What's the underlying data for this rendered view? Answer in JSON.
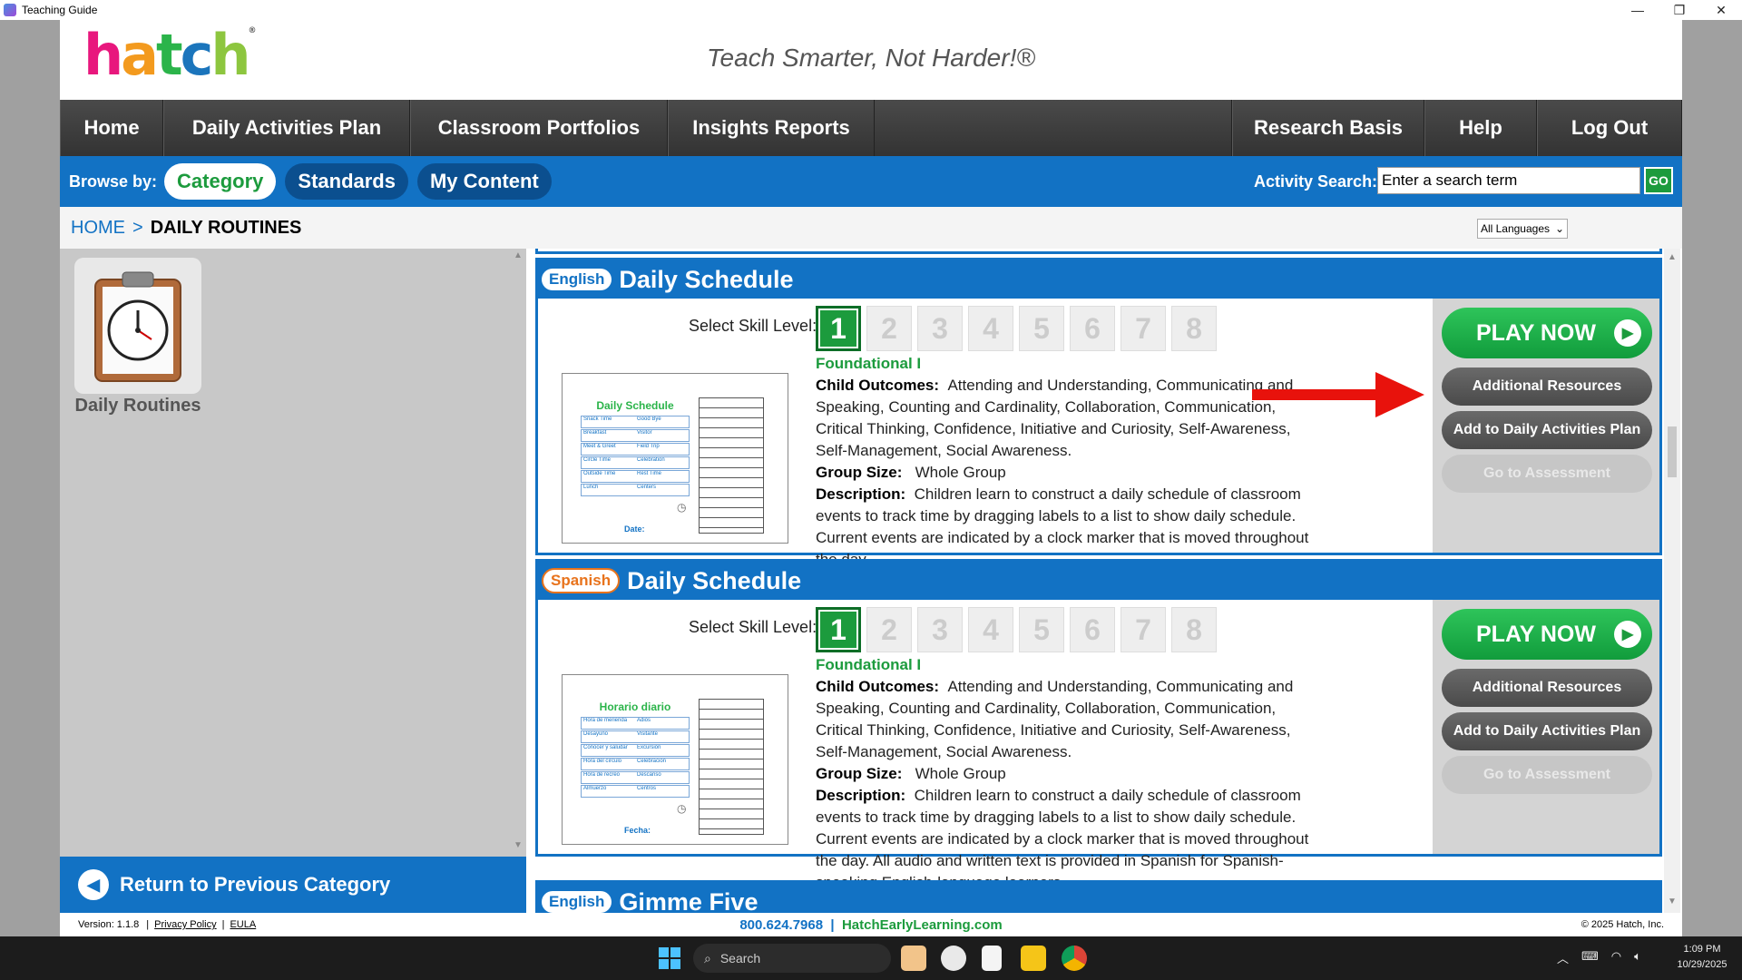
{
  "window": {
    "title": "Teaching Guide",
    "minimize": "—",
    "restore": "❐",
    "close": "✕"
  },
  "header": {
    "logo": {
      "h": "h",
      "a": "a",
      "t": "t",
      "c": "c",
      "h2": "h",
      "reg": "®"
    },
    "tagline": "Teach Smarter, Not Harder!®"
  },
  "nav": {
    "home": "Home",
    "daily_activities_plan": "Daily Activities Plan",
    "classroom_portfolios": "Classroom Portfolios",
    "insights_reports": "Insights Reports",
    "research_basis": "Research Basis",
    "help": "Help",
    "log_out": "Log Out"
  },
  "browse": {
    "label": "Browse by:",
    "category": "Category",
    "standards": "Standards",
    "my_content": "My Content",
    "search_label": "Activity Search:",
    "search_value": "Enter a search term",
    "go": "GO"
  },
  "breadcrumb": {
    "home": "HOME",
    "sep": ">",
    "current": "DAILY ROUTINES",
    "language": "All Languages",
    "language_caret": "⌄"
  },
  "left_panel": {
    "category_label": "Daily Routines",
    "return_label": "Return to Previous Category",
    "return_icon": "◀"
  },
  "skill_label": "Select Skill Level:",
  "skill_levels": [
    "1",
    "2",
    "3",
    "4",
    "5",
    "6",
    "7",
    "8"
  ],
  "cards": [
    {
      "language": "English",
      "title": "Daily Schedule",
      "level": "Foundational I",
      "outcomes_label": "Child Outcomes:",
      "outcomes": "Attending and Understanding, Communicating and Speaking, Counting and Cardinality, Collaboration, Communication, Critical Thinking, Confidence, Initiative and Curiosity, Self-Awareness, Self-Management, Social Awareness.",
      "group_label": "Group Size:",
      "group": "Whole Group",
      "description_label": "Description:",
      "description": "Children learn to construct a daily schedule of classroom events to track time by dragging labels to a list to show daily schedule. Current events are indicated by a clock marker that is moved throughout the day.",
      "thumb_title": "Daily Schedule",
      "thumb_rows": [
        [
          "Snack Time",
          "Good Bye"
        ],
        [
          "Breakfast",
          "Visitor"
        ],
        [
          "Meet & Greet",
          "Field Trip"
        ],
        [
          "Circle Time",
          "Celebration"
        ],
        [
          "Outside Time",
          "Rest Time"
        ],
        [
          "Lunch",
          "Centers"
        ]
      ],
      "thumb_date": "Date:"
    },
    {
      "language": "Spanish",
      "title": "Daily Schedule",
      "level": "Foundational I",
      "outcomes_label": "Child Outcomes:",
      "outcomes": "Attending and Understanding, Communicating and Speaking, Counting and Cardinality, Collaboration, Communication, Critical Thinking, Confidence, Initiative and Curiosity, Self-Awareness, Self-Management, Social Awareness.",
      "group_label": "Group Size:",
      "group": "Whole Group",
      "description_label": "Description:",
      "description": "Children learn to construct a daily schedule of classroom events to track time by dragging labels to a list to show daily schedule. Current events are indicated by a clock marker that is moved throughout the day. All audio and written text is provided in Spanish for Spanish-speaking English-language learners.",
      "thumb_title": "Horario diario",
      "thumb_rows": [
        [
          "Hora de merienda",
          "Adiós"
        ],
        [
          "Desayuno",
          "Visitante"
        ],
        [
          "Conocer y saludar",
          "Excursión"
        ],
        [
          "Hora del círculo",
          "Celebración"
        ],
        [
          "Hora de recreo",
          "Descanso"
        ],
        [
          "Almuerzo",
          "Centros"
        ]
      ],
      "thumb_date": "Fecha:"
    },
    {
      "language": "English",
      "title": "Gimme Five"
    }
  ],
  "buttons": {
    "play_now": "PLAY NOW",
    "play_icon": "▶",
    "additional_resources": "Additional Resources",
    "add_to_plan": "Add to Daily Activities Plan",
    "go_to_assessment": "Go to Assessment"
  },
  "footer": {
    "version": "Version: 1.1.8",
    "privacy": "Privacy Policy",
    "eula": "EULA",
    "sep": "|",
    "phone": "800.624.7968",
    "website": "HatchEarlyLearning.com",
    "copyright": "© 2025 Hatch, Inc."
  },
  "taskbar": {
    "search": "Search",
    "time": "1:09 PM",
    "date": "10/29/2025"
  },
  "colors": {
    "brand_blue": "#1272c4",
    "brand_green": "#1c9b3d",
    "nav_dark": "#3a3a3a",
    "arrow_red": "#e8120c"
  }
}
